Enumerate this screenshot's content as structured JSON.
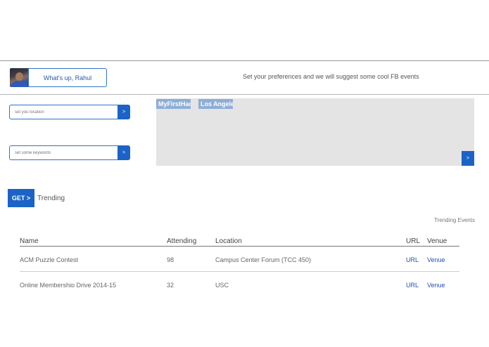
{
  "header": {
    "greeting": "What's up, Rahul",
    "tagline": "Set your preferences and we will suggest some cool FB events"
  },
  "filters": {
    "location_placeholder": "set you location",
    "keywords_placeholder": "set some keywords",
    "go_label": ">"
  },
  "tags": [
    "MyFirstHac",
    "Los Angele"
  ],
  "panel_go_label": ">",
  "get_button": "GET >",
  "trending_label": "Trending",
  "trending_events_label": "Trending Events",
  "table": {
    "columns": [
      "Name",
      "Attending",
      "Location",
      "URL",
      "Venue"
    ],
    "rows": [
      {
        "name": "ACM Puzzle Contest",
        "attending": "98",
        "location": "Campus Center Forum (TCC 450)",
        "url": "URL",
        "venue": "Venue"
      },
      {
        "name": "Online Membership Drive 2014-15",
        "attending": "32",
        "location": "USC",
        "url": "URL",
        "venue": "Venue"
      }
    ]
  },
  "colors": {
    "accent": "#1b63c6",
    "tag": "#8eaed7",
    "panel": "#e4e4e4"
  }
}
